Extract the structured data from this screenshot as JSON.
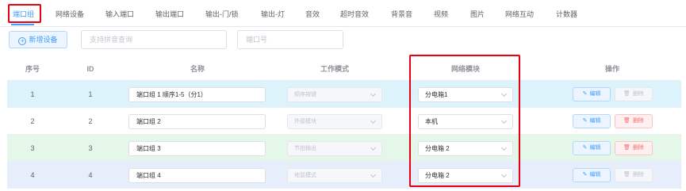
{
  "tabs": [
    {
      "label": "端口组",
      "active": true
    },
    {
      "label": "网络设备",
      "active": false
    },
    {
      "label": "输入端口",
      "active": false
    },
    {
      "label": "输出端口",
      "active": false
    },
    {
      "label": "输出-门/锁",
      "active": false
    },
    {
      "label": "输出-灯",
      "active": false
    },
    {
      "label": "音效",
      "active": false
    },
    {
      "label": "超时音效",
      "active": false
    },
    {
      "label": "背景音",
      "active": false
    },
    {
      "label": "视频",
      "active": false
    },
    {
      "label": "图片",
      "active": false
    },
    {
      "label": "网络互动",
      "active": false
    },
    {
      "label": "计数器",
      "active": false
    }
  ],
  "toolbar": {
    "add_label": "新增设备",
    "search_placeholder": "支持拼音查询",
    "port_placeholder": "端口号"
  },
  "table": {
    "headers": {
      "index": "序号",
      "id": "ID",
      "name": "名称",
      "mode": "工作模式",
      "network": "网络模块",
      "actions": "操作"
    },
    "rows": [
      {
        "index": "1",
        "id": "1",
        "name": "端口组 1 顺序1-5（分1）",
        "mode": "顺序按键",
        "network": "分电箱1",
        "edit": "编辑",
        "delete": "删除",
        "delete_disabled": true
      },
      {
        "index": "2",
        "id": "2",
        "name": "端口组 2",
        "mode": "外接模块",
        "network": "本机",
        "edit": "编辑",
        "delete": "删除",
        "delete_disabled": false
      },
      {
        "index": "3",
        "id": "3",
        "name": "端口组 3",
        "mode": "节拍输出",
        "network": "分电箱 2",
        "edit": "编辑",
        "delete": "删除",
        "delete_disabled": false
      },
      {
        "index": "4",
        "id": "4",
        "name": "端口组 4",
        "mode": "地鼠模式",
        "network": "分电箱 2",
        "edit": "编辑",
        "delete": "删除",
        "delete_disabled": true
      }
    ]
  },
  "colors": {
    "accent": "#409eff",
    "highlight_box": "#e60012",
    "danger": "#f56c6c"
  },
  "icons": {
    "add": "plus-circle-icon",
    "edit": "pencil-icon",
    "delete": "trash-icon",
    "select": "chevron-down-icon"
  }
}
